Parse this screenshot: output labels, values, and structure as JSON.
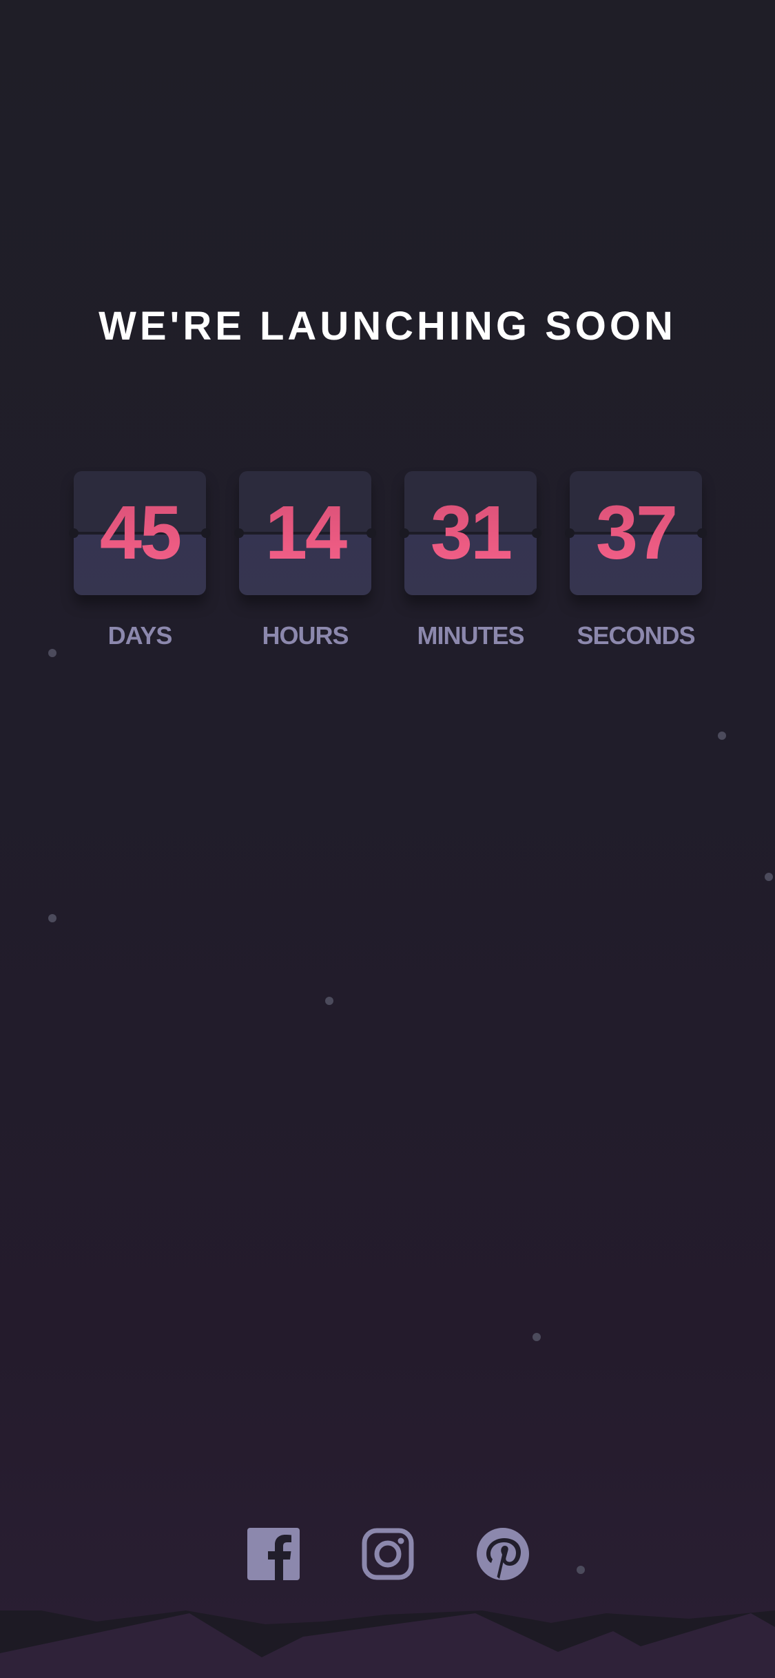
{
  "page": {
    "title": "WE'RE LAUNCHING SOON"
  },
  "countdown": [
    {
      "value": "45",
      "label": "DAYS"
    },
    {
      "value": "14",
      "label": "HOURS"
    },
    {
      "value": "31",
      "label": "MINUTES"
    },
    {
      "value": "37",
      "label": "SECONDS"
    }
  ],
  "social": [
    {
      "icon": "facebook-icon"
    },
    {
      "icon": "instagram-icon"
    },
    {
      "icon": "pinterest-icon"
    }
  ],
  "colors": {
    "background": "#1f1e27",
    "accent": "#f0597c",
    "label": "#8c88ad",
    "card": "#2c2b3d",
    "social_icon": "#8c88ad"
  }
}
